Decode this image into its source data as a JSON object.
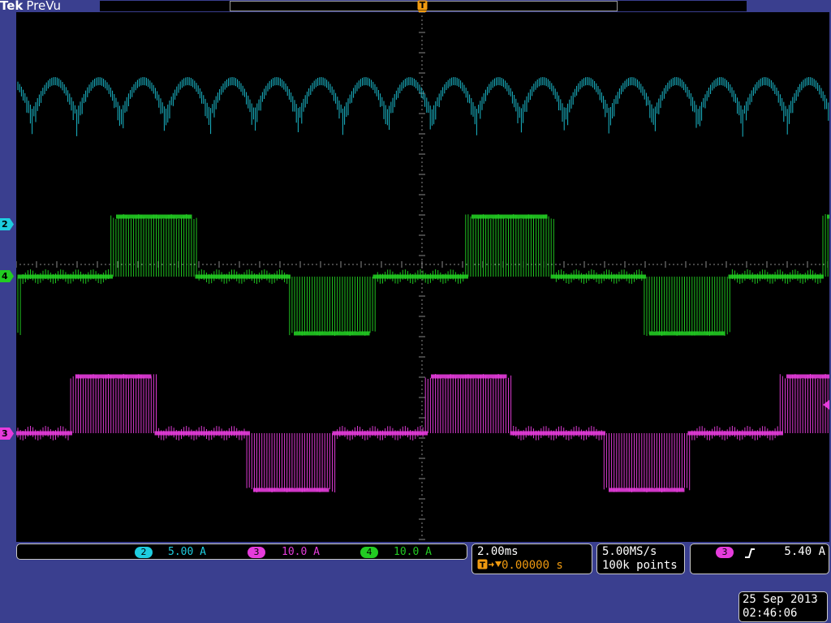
{
  "header": {
    "brand": "Tek",
    "mode": "PreVu",
    "trigger_position_marker": "T"
  },
  "colors": {
    "ch2": "#1ecde0",
    "ch3": "#e63cdc",
    "ch4": "#22cc22",
    "accent": "#f09a10",
    "frame": "#3a3f8f"
  },
  "channels": [
    {
      "id": "2",
      "scale": "5.00 A",
      "color": "#1ecde0"
    },
    {
      "id": "3",
      "scale": "10.0 A",
      "color": "#e63cdc"
    },
    {
      "id": "4",
      "scale": "10.0 A",
      "color": "#22cc22"
    }
  ],
  "horizontal": {
    "time_per_div": "2.00ms",
    "trigger_delay": "0.00000 s"
  },
  "acquisition": {
    "sample_rate": "5.00MS/s",
    "record_length": "100k points"
  },
  "trigger": {
    "source": "3",
    "slope_icon": "rising-edge-icon",
    "level": "5.40 A"
  },
  "datetime": {
    "date": "25 Sep  2013",
    "time": "02:46:06"
  }
}
